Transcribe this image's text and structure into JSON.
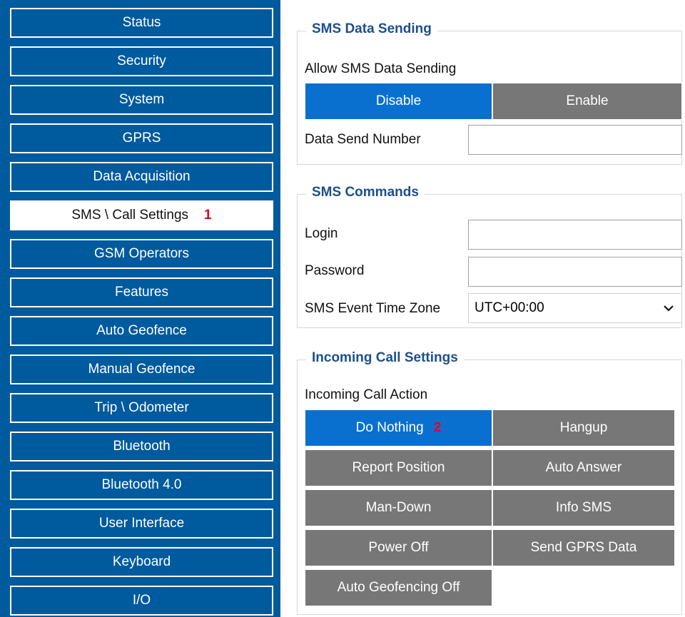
{
  "sidebar": {
    "items": [
      {
        "label": "Status"
      },
      {
        "label": "Security"
      },
      {
        "label": "System"
      },
      {
        "label": "GPRS"
      },
      {
        "label": "Data Acquisition"
      },
      {
        "label": "SMS \\ Call Settings",
        "badge": "1"
      },
      {
        "label": "GSM Operators"
      },
      {
        "label": "Features"
      },
      {
        "label": "Auto Geofence"
      },
      {
        "label": "Manual Geofence"
      },
      {
        "label": "Trip \\ Odometer"
      },
      {
        "label": "Bluetooth"
      },
      {
        "label": "Bluetooth 4.0"
      },
      {
        "label": "User Interface"
      },
      {
        "label": "Keyboard"
      },
      {
        "label": "I/O"
      }
    ],
    "active_index": 5
  },
  "sms_data_sending": {
    "title": "SMS Data Sending",
    "allow_label": "Allow SMS Data Sending",
    "disable_label": "Disable",
    "enable_label": "Enable",
    "selected": "Disable",
    "number_label": "Data Send Number",
    "number_value": ""
  },
  "sms_commands": {
    "title": "SMS Commands",
    "login_label": "Login",
    "login_value": "",
    "password_label": "Password",
    "password_value": "",
    "timezone_label": "SMS Event Time Zone",
    "timezone_value": "UTC+00:00"
  },
  "incoming_call": {
    "title": "Incoming Call Settings",
    "action_label": "Incoming Call Action",
    "options": {
      "do_nothing": "Do Nothing",
      "do_nothing_badge": "2",
      "hangup": "Hangup",
      "report_position": "Report Position",
      "auto_answer": "Auto Answer",
      "man_down": "Man-Down",
      "info_sms": "Info SMS",
      "power_off": "Power Off",
      "send_gprs_data": "Send GPRS Data",
      "auto_geofencing_off": "Auto Geofencing Off"
    },
    "selected": "Do Nothing"
  },
  "colors": {
    "sidebar_bg": "#005a9e",
    "selected_blue": "#0a70cf",
    "unselected_gray": "#777777",
    "legend_blue": "#1d4f8c",
    "badge_red": "#e8001c"
  }
}
